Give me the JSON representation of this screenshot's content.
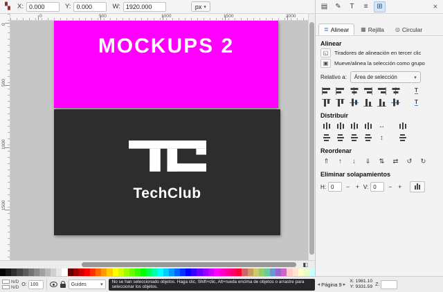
{
  "toolbar": {
    "x_label": "X:",
    "x_value": "0.000",
    "y_label": "Y:",
    "y_value": "0.000",
    "w_label": "W:",
    "w_value": "1920.000",
    "unit": "px"
  },
  "icons": {
    "document": "▤",
    "pencil": "✎",
    "text": "T",
    "layers": "≡",
    "align": "⊞",
    "close": "×",
    "align_tab": "≣",
    "grid_tab": "▦",
    "circular_tab": "◎",
    "caret": "▾",
    "handles": "◱",
    "group": "▣",
    "arrow_h": "↔",
    "arrow_v": "↕",
    "raise_top": "⇑",
    "raise": "↑",
    "lower": "↓",
    "lower_bottom": "⇓",
    "stack": "⇅",
    "exchange": "⇄",
    "rotate_ccw": "↺",
    "rotate_cw": "↻",
    "minus": "−",
    "plus": "+",
    "prev": "◂",
    "next": "▸",
    "cms": "◧",
    "misc": "▚",
    "text_align": "T"
  },
  "rulers": {
    "h": [
      "0",
      "500",
      "1000",
      "1500",
      "2000"
    ],
    "v": [
      "0",
      "500",
      "1000",
      "1500"
    ]
  },
  "canvas": {
    "page1": {
      "text": "MOCKUPS 2",
      "bg": "#ff00ff"
    },
    "page2": {
      "brand": "TechClub",
      "bg": "#2d2d2d"
    }
  },
  "align_panel": {
    "tabs": [
      "Alinear",
      "Rejilla",
      "Circular"
    ],
    "section_align": "Alinear",
    "option_handles": "Tiradores de alineación en tercer clic",
    "option_group": "Mueve/alinea la selección como grupo",
    "relative_label": "Relativo a:",
    "relative_value": "Área de selección",
    "section_distribute": "Distribuir",
    "section_reorder": "Reordenar",
    "section_overlap": "Eliminar solapamientos",
    "h_label": "H:",
    "h_value": "0",
    "v_label": "V:",
    "v_value": "0"
  },
  "statusbar": {
    "fill": "N/D",
    "stroke": "N/D",
    "opacity_label": "O:",
    "opacity_value": "100",
    "layer": "Guides",
    "message": "No se han seleccionado objetos. Haga clic, Shift+clic, Alt+rueda encima de objetos o arrastre para seleccionar los objetos.",
    "page": "Página 9",
    "x": "X: 1981.10",
    "y": "Y: 9331.59",
    "z_label": "Z:"
  },
  "palette": {
    "colors": [
      "#000000",
      "#171717",
      "#2e2e2e",
      "#454545",
      "#5c5c5c",
      "#737373",
      "#8a8a8a",
      "#a1a1a1",
      "#b8b8b8",
      "#cfcfcf",
      "#e6e6e6",
      "#ffffff",
      "#660000",
      "#990000",
      "#cc0000",
      "#ff0000",
      "#ff3300",
      "#ff6600",
      "#ff9900",
      "#ffcc00",
      "#ffff00",
      "#ccff00",
      "#99ff00",
      "#66ff00",
      "#33ff00",
      "#00ff00",
      "#00ff55",
      "#00ffaa",
      "#00ffff",
      "#00ccff",
      "#0099ff",
      "#0066ff",
      "#0033ff",
      "#0000ff",
      "#3300ff",
      "#6600ff",
      "#9900ff",
      "#cc00ff",
      "#ff00ff",
      "#ff00cc",
      "#ff0099",
      "#ff0066",
      "#ff0033",
      "#cc6666",
      "#cc9966",
      "#cccc66",
      "#99cc66",
      "#66cc99",
      "#6699cc",
      "#9966cc",
      "#cc66cc",
      "#ffcccc",
      "#ffe6cc",
      "#ffffcc",
      "#e6ffcc",
      "#ccffff"
    ]
  },
  "colors": {
    "accent": "#3584e4",
    "canvas_bg": "#c6c6c6",
    "message_bg": "#26262b"
  }
}
